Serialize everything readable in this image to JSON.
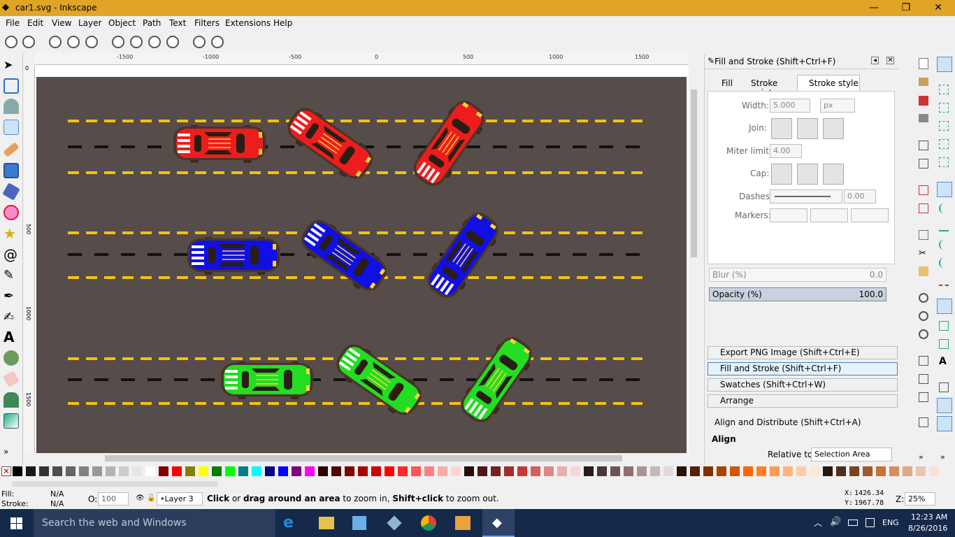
{
  "window": {
    "title": "car1.svg - Inkscape",
    "minimize": "—",
    "maximize": "❐",
    "close": "✕"
  },
  "menu": [
    "File",
    "Edit",
    "View",
    "Layer",
    "Object",
    "Path",
    "Text",
    "Filters",
    "Extensions",
    "Help"
  ],
  "ruler_h_labels": [
    "-1500",
    "-1000",
    "-500",
    "0",
    "500",
    "1000",
    "1500"
  ],
  "ruler_v_labels": [
    "0",
    "500",
    "1000",
    "1500"
  ],
  "fill_stroke_panel": {
    "title": "Fill and Stroke (Shift+Ctrl+F)",
    "tabs": [
      "Fill",
      "Stroke paint",
      "Stroke style"
    ],
    "width_label": "Width:",
    "width_value": "5.000",
    "width_unit": "px",
    "join_label": "Join:",
    "miter_label": "Miter limit:",
    "miter_value": "4.00",
    "cap_label": "Cap:",
    "dashes_label": "Dashes:",
    "dashes_value": "0.00",
    "markers_label": "Markers:",
    "blur_label": "Blur (%)",
    "blur_value": "0.0",
    "opacity_label": "Opacity (%)",
    "opacity_value": "100.0"
  },
  "collapsed_panels": [
    "Export PNG Image (Shift+Ctrl+E)",
    "Fill and Stroke (Shift+Ctrl+F)",
    "Swatches (Shift+Ctrl+W)",
    "Arrange"
  ],
  "align_panel": {
    "title": "Align and Distribute (Shift+Ctrl+A)",
    "section": "Align",
    "relative_label": "Relative to:",
    "relative_value": "Selection Area"
  },
  "status": {
    "fill_label": "Fill:",
    "fill_value": "N/A",
    "stroke_label": "Stroke:",
    "stroke_value": "N/A",
    "opacity_label": "O:",
    "opacity_value": "100",
    "layer": "•Layer 3",
    "message_bold1": "Click",
    "message_1": " or ",
    "message_bold2": "drag around an area",
    "message_2": " to zoom in, ",
    "message_bold3": "Shift+click",
    "message_3": " to zoom out.",
    "x_label": "X:",
    "x_value": "1426.34",
    "y_label": "Y:",
    "y_value": "1967.78",
    "zoom_label": "Z:",
    "zoom_value": "25%"
  },
  "taskbar": {
    "search_placeholder": "Search the web and Windows",
    "lang": "ENG",
    "time": "12:23 AM",
    "date": "8/26/2016"
  },
  "palette": [
    "#000000",
    "#1a1a1a",
    "#333333",
    "#4d4d4d",
    "#666666",
    "#808080",
    "#999999",
    "#b3b3b3",
    "#cccccc",
    "#e6e6e6",
    "#ffffff",
    "#800000",
    "#ff0000",
    "#808000",
    "#ffff00",
    "#008000",
    "#00ff00",
    "#008080",
    "#00ffff",
    "#000080",
    "#0000ff",
    "#800080",
    "#ff00ff",
    "#2b0000",
    "#550000",
    "#800000",
    "#aa0000",
    "#d40000",
    "#ff0000",
    "#ff2a2a",
    "#ff5555",
    "#ff8080",
    "#ffaaaa",
    "#ffd5d5",
    "#280b0b",
    "#501616",
    "#782121",
    "#a02c2c",
    "#c83737",
    "#d35f5f",
    "#de8787",
    "#e9afaf",
    "#f4d7d7",
    "#241c1c",
    "#483737",
    "#6c5353",
    "#916f6f",
    "#ac9393",
    "#c8b7b7",
    "#e3dbdb",
    "#2b1100",
    "#552200",
    "#803300",
    "#aa4400",
    "#d45500",
    "#ff6600",
    "#ff7f2a",
    "#ff9955",
    "#ffb380",
    "#ffccaa",
    "#ffe6d5",
    "#28170b",
    "#502d16",
    "#784421",
    "#a05a2c",
    "#c87137",
    "#d38d5f",
    "#deaa87",
    "#e9c6af",
    "#f4e3d7"
  ],
  "cars": [
    {
      "color": "#ee1d1d",
      "row": 0,
      "angle": 0
    },
    {
      "color": "#ee1d1d",
      "row": 0,
      "angle": 35
    },
    {
      "color": "#ee1d1d",
      "row": 0,
      "angle": -55
    },
    {
      "color": "#1010e6",
      "row": 1,
      "angle": 0
    },
    {
      "color": "#1010e6",
      "row": 1,
      "angle": 35
    },
    {
      "color": "#1010e6",
      "row": 1,
      "angle": -55
    },
    {
      "color": "#22dd22",
      "row": 2,
      "angle": 0
    },
    {
      "color": "#22dd22",
      "row": 2,
      "angle": 35
    },
    {
      "color": "#22dd22",
      "row": 2,
      "angle": -55
    }
  ]
}
